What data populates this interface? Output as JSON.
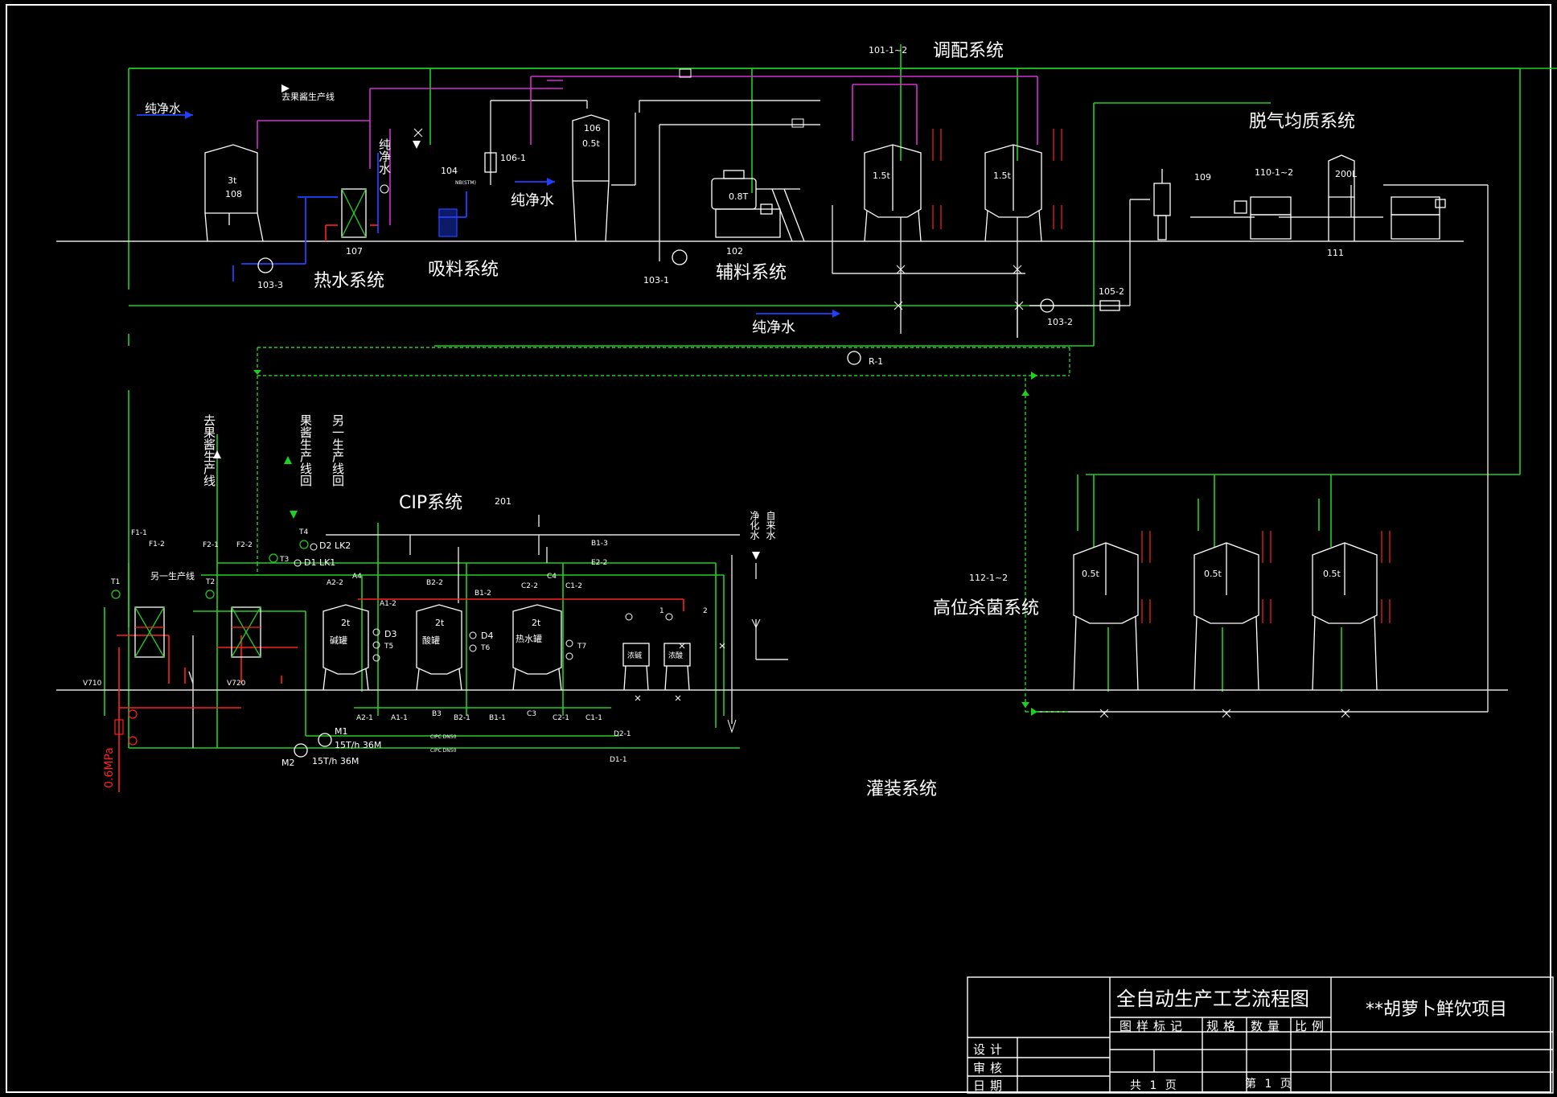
{
  "colors": {
    "green": "#20d020",
    "magenta": "#d030d0",
    "blue": "#2040ff",
    "red": "#ff2020",
    "white": "#ffffff",
    "background": "#000000"
  },
  "systems": {
    "blending": "调配系统",
    "deaeration": "脱气均质系统",
    "hot_water": "热水系统",
    "suction": "吸料系统",
    "auxiliary": "辅料系统",
    "cip": "CIP系统",
    "high_sterilization": "高位杀菌系统",
    "filling": "灌装系统"
  },
  "labels": {
    "pure_water": "纯净水",
    "pure_water_small": "纯净水",
    "to_puree_line": "去果酱生产线",
    "pure_water_vertical": "纯净水",
    "to_puree_line_vertical": "去果酱生产线",
    "puree_line_return_vertical": "果酱生产线回",
    "another_line_return_vertical": "另一生产线回",
    "another_line": "另一生产线",
    "purified_water_vertical": "净化水",
    "tap_water_vertical": "自来水",
    "pressure": "0.6MPa"
  },
  "equipment": {
    "t101": "101-1~2",
    "t108": "108",
    "t108_cap": "3t",
    "t107": "107",
    "p1033": "103-3",
    "t104": "104",
    "t104_tag": "NB(STM)",
    "t1061": "106-1",
    "t106": "106",
    "t106_cap": "0.5t",
    "t102": "102",
    "t102_cap": "0.8T",
    "p1031": "103-1",
    "t101a_cap": "1.5t",
    "t101b_cap": "1.5t",
    "t109": "109",
    "t110": "110-1~2",
    "t111": "111",
    "t111_cap": "200L",
    "h1052": "105-2",
    "p1032": "103-2",
    "r1": "R-1",
    "c201": "201",
    "t112": "112-1~2",
    "s1_cap": "0.5t",
    "s2_cap": "0.5t",
    "s3_cap": "0.5t"
  },
  "cip": {
    "tank_cap": "2t",
    "alkali_tank": "碱罐",
    "acid_tank": "酸罐",
    "hot_water_tank": "热水罐",
    "conc_alkali": "浓碱",
    "conc_acid": "浓酸",
    "pump1": "M1",
    "pump1_rate": "15T/h 36M",
    "pump2": "M2",
    "pump2_rate": "15T/h 36M",
    "pipe1": "CIPC DN50",
    "pipe2": "CIPC DN50"
  },
  "valves": {
    "F11": "F1-1",
    "F12": "F1-2",
    "F21": "F2-1",
    "F22": "F2-2",
    "T1": "T1",
    "T2": "T2",
    "T3": "T3",
    "T4": "T4",
    "D2LK2": "D2 LK2",
    "D1LK1": "D1 LK1",
    "A22": "A2-2",
    "A4": "A4",
    "A12": "A1-2",
    "B22": "B2-2",
    "B12": "B1-2",
    "C22": "C2-2",
    "C4": "C4",
    "C12": "C1-2",
    "B13": "B1-3",
    "E22": "E2-2",
    "D3": "D3",
    "T5": "T5",
    "D4": "D4",
    "T6": "T6",
    "T7": "T7",
    "A21": "A2-1",
    "A11": "A1-1",
    "B3": "B3",
    "B21": "B2-1",
    "B11": "B1-1",
    "C3": "C3",
    "C21": "C2-1",
    "C11": "C1-1",
    "D21": "D2-1",
    "D11": "D1-1",
    "V710": "V710",
    "V720": "V720",
    "n1": "1",
    "n2": "2"
  },
  "title_block": {
    "title": "全自动生产工艺流程图",
    "project": "**胡萝卜鲜饮项目",
    "h_mark": "图样标记",
    "h_spec": "规格",
    "h_qty": "数量",
    "h_scale": "比例",
    "design": "设计",
    "review": "审核",
    "date": "日期",
    "total_pages": "共 1 页",
    "page_no": "第 1 页"
  }
}
